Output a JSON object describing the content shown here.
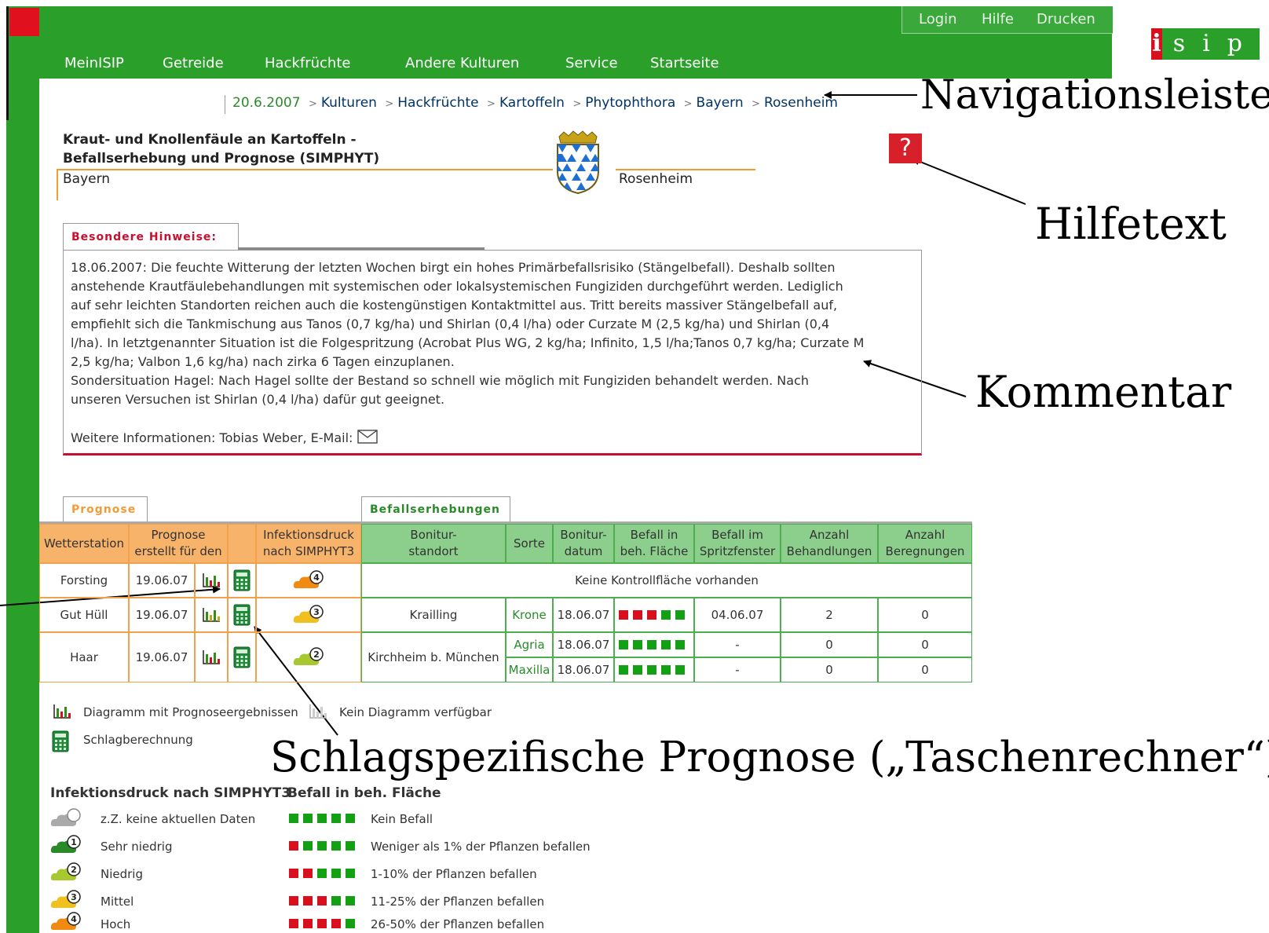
{
  "top_links": [
    "Login",
    "Hilfe",
    "Drucken"
  ],
  "logo": {
    "first": "i",
    "rest": "sip"
  },
  "nav_items": [
    "MeinISIP",
    "Getreide",
    "Hackfrüchte",
    "Andere Kulturen",
    "Service",
    "Startseite"
  ],
  "breadcrumb": {
    "date": "20.6.2007",
    "items": [
      "Kulturen",
      "Hackfrüchte",
      "Kartoffeln",
      "Phytophthora",
      "Bayern",
      "Rosenheim"
    ]
  },
  "annotations": {
    "navigation": "Navigationsleiste",
    "help": "Hilfetext",
    "comment": "Kommentar",
    "calculator": "Schlagspezifische Prognose („Taschenrechner“)"
  },
  "title": {
    "line1": "Kraut- und Knollenfäule an Kartoffeln -",
    "line2": "Befallserhebung und Prognose (SIMPHYT)",
    "state": "Bayern",
    "district": "Rosenheim"
  },
  "help_button": "?",
  "hints": {
    "tab_label": "Besondere Hinweise:",
    "lines": [
      "18.06.2007: Die feuchte Witterung der letzten Wochen birgt ein hohes Primärbefallsrisiko (Stängelbefall). Deshalb sollten",
      "anstehende Krautfäulebehandlungen mit systemischen oder lokalsystemischen Fungiziden durchgeführt werden. Lediglich",
      "auf sehr leichten Standorten reichen auch die kostengünstigen Kontaktmittel aus. Tritt bereits massiver Stängelbefall auf,",
      "empfiehlt sich die Tankmischung aus Tanos (0,7 kg/ha) und Shirlan (0,4 l/ha) oder Curzate M (2,5 kg/ha) und Shirlan (0,4",
      "l/ha). In letztgenannter Situation ist die Folgespritzung (Acrobat Plus WG, 2 kg/ha; Infinito, 1,5 l/ha;Tanos 0,7 kg/ha; Curzate M",
      "2,5 kg/ha; Valbon 1,6 kg/ha) nach zirka 6 Tagen einzuplanen.",
      "Sondersituation Hagel: Nach Hagel sollte der Bestand so schnell wie möglich mit Fungiziden behandelt werden. Nach",
      "unseren Versuchen ist Shirlan (0,4 l/ha) dafür gut geeignet."
    ],
    "contact": "Weitere Informationen: Tobias Weber, E-Mail:"
  },
  "prognosis": {
    "tab_label": "Prognose",
    "headers": {
      "station": "Wetterstation",
      "forecast_line1": "Prognose",
      "forecast_line2": "erstellt für den",
      "pressure_line1": "Infektionsdruck",
      "pressure_line2": "nach SIMPHYT3"
    },
    "rows": [
      {
        "station": "Forsting",
        "date": "19.06.07",
        "level": "4"
      },
      {
        "station": "Gut Hüll",
        "date": "19.06.07",
        "level": "3"
      },
      {
        "station": "Haar",
        "date": "19.06.07",
        "level": "2"
      }
    ]
  },
  "survey": {
    "tab_label": "Befallserhebungen",
    "headers": {
      "site_line1": "Bonitur-",
      "site_line2": "standort",
      "variety": "Sorte",
      "date_line1": "Bonitur-",
      "date_line2": "datum",
      "infest_line1": "Befall in",
      "infest_line2": "beh. Fläche",
      "window_line1": "Befall im",
      "window_line2": "Spritzfenster",
      "treat_line1": "Anzahl",
      "treat_line2": "Behandlungen",
      "irrig_line1": "Anzahl",
      "irrig_line2": "Beregnungen"
    },
    "no_area": "Keine Kontrollfläche vorhanden",
    "rows": [
      {
        "site": "Krailling",
        "variety": "Krone",
        "date": "18.06.07",
        "red": 3,
        "window": "04.06.07",
        "treatments": "2",
        "irrigations": "0"
      },
      {
        "site": "Kirchheim b. München",
        "variety": "Agria",
        "date": "18.06.07",
        "red": 0,
        "window": "-",
        "treatments": "0",
        "irrigations": "0"
      },
      {
        "site": "",
        "variety": "Maxilla",
        "date": "18.06.07",
        "red": 0,
        "window": "-",
        "treatments": "0",
        "irrigations": "0"
      }
    ]
  },
  "legend": {
    "chart": "Diagramm mit Prognoseergebnissen",
    "no_chart": "Kein Diagramm verfügbar",
    "calc": "Schlagberechnung",
    "pressure_title": "Infektionsdruck nach SIMPHYT3",
    "infest_title": "Befall in beh. Fläche",
    "pressure_levels": [
      "z.Z. keine aktuellen Daten",
      "Sehr niedrig",
      "Niedrig",
      "Mittel",
      "Hoch"
    ],
    "infest_levels": [
      "Kein Befall",
      "Weniger als 1% der Pflanzen befallen",
      "1-10% der Pflanzen befallen",
      "11-25% der Pflanzen befallen",
      "26-50% der Pflanzen befallen"
    ]
  },
  "colors": {
    "frame_green": "#2aa02a",
    "accent_red": "#d8101e",
    "orange": "#f29b37"
  }
}
